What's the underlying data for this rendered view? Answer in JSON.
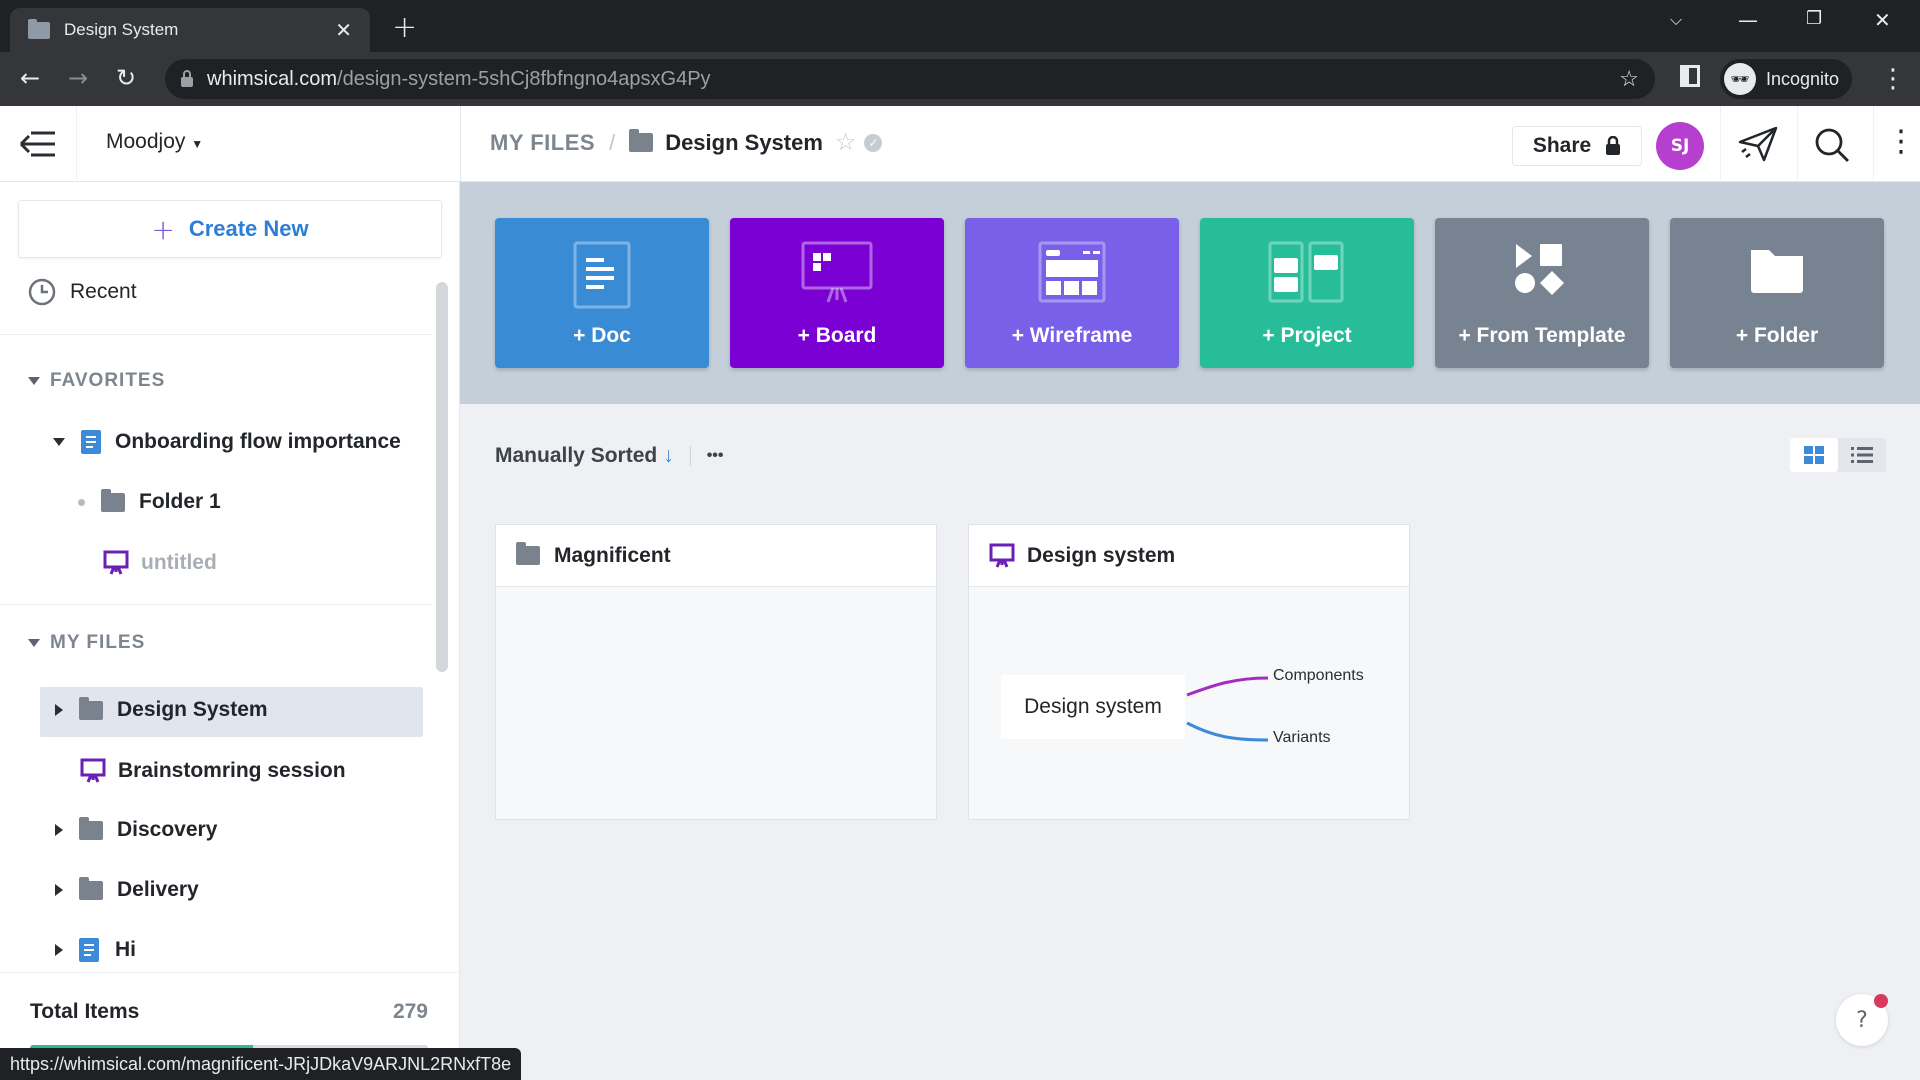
{
  "browser": {
    "tab_title": "Design System",
    "url_host": "whimsical.com",
    "url_path": "/design-system-5shCj8fbfngno4apsxG4Py",
    "profile_label": "Incognito",
    "status_url": "https://whimsical.com/magnificent-JRjJDkaV9ARJNL2RNxfT8e"
  },
  "header": {
    "workspace": "Moodjoy",
    "breadcrumb_root": "MY FILES",
    "breadcrumb_sep": "/",
    "breadcrumb_current": "Design System",
    "share_label": "Share",
    "avatar_initials": "SJ",
    "avatar_color": "#b63fd0"
  },
  "sidebar": {
    "create_new": "Create New",
    "recent": "Recent",
    "favorites_title": "FAVORITES",
    "favorites": [
      {
        "label": "Onboarding flow importance",
        "type": "doc"
      },
      {
        "label": "Folder 1",
        "type": "folder"
      },
      {
        "label": "untitled",
        "type": "board"
      }
    ],
    "myfiles_title": "MY FILES",
    "myfiles": [
      {
        "label": "Design System",
        "type": "folder",
        "selected": true
      },
      {
        "label": "Brainstomring session",
        "type": "board"
      },
      {
        "label": "Discovery",
        "type": "folder"
      },
      {
        "label": "Delivery",
        "type": "folder"
      },
      {
        "label": "Hi",
        "type": "doc"
      }
    ],
    "total_items_label": "Total Items",
    "total_items_value": "279",
    "usage_fraction": 0.56
  },
  "tiles": [
    {
      "label": "+ Doc",
      "color": "#3a8bd6"
    },
    {
      "label": "+ Board",
      "color": "#7b00d4"
    },
    {
      "label": "+ Wireframe",
      "color": "#7860e8"
    },
    {
      "label": "+ Project",
      "color": "#26bd98"
    },
    {
      "label": "+ From Template",
      "color": "#778390"
    },
    {
      "label": "+ Folder",
      "color": "#778390"
    }
  ],
  "toolbar": {
    "sort_label": "Manually Sorted",
    "more": "•••"
  },
  "cards": [
    {
      "title": "Magnificent",
      "type": "folder"
    },
    {
      "title": "Design system",
      "type": "board",
      "preview": {
        "root": "Design system",
        "children": [
          "Components",
          "Variants"
        ]
      }
    }
  ],
  "help": "?"
}
